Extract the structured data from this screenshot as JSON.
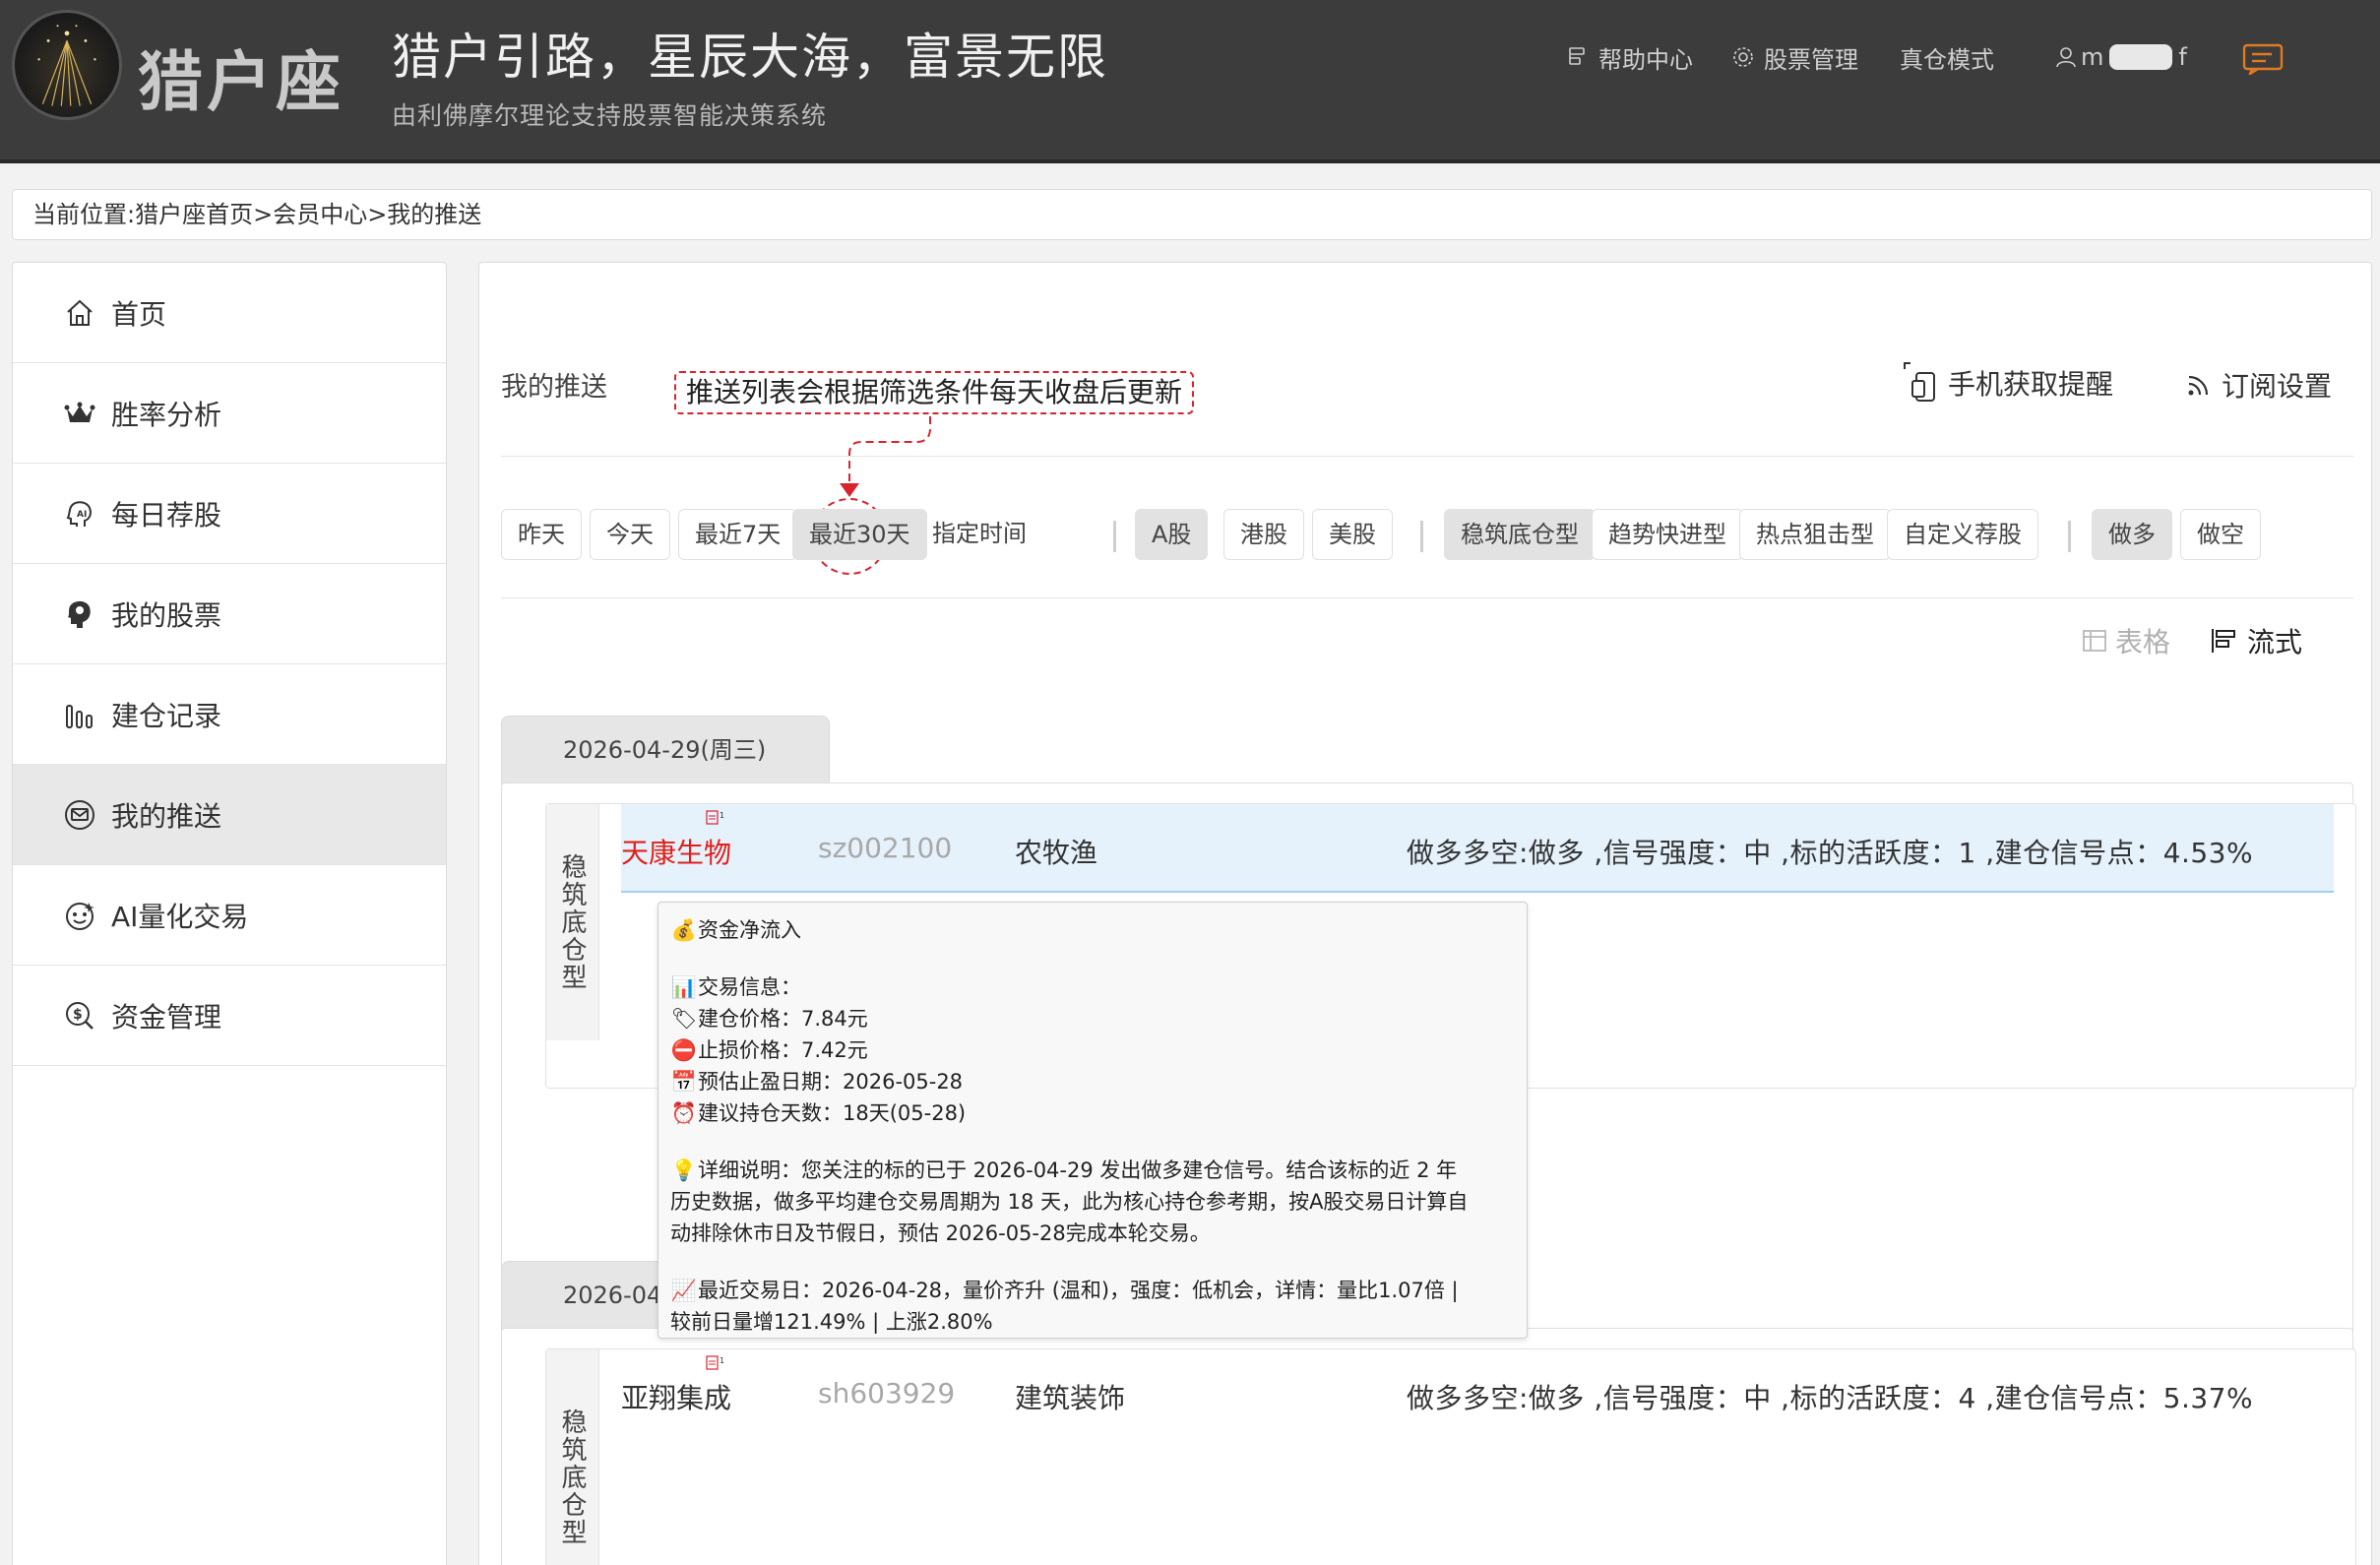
{
  "header": {
    "logo_text": "猎户座",
    "slogan": "猎户引路，星辰大海，富景无限",
    "subslogan": "由利佛摩尔理论支持股票智能决策系统",
    "nav": {
      "help": "帮助中心",
      "stock_mgmt": "股票管理",
      "real_mode": "真仓模式",
      "user_prefix": "m",
      "user_suffix": "f"
    }
  },
  "breadcrumb": "当前位置:猎户座首页>会员中心>我的推送",
  "sidebar": {
    "items": [
      {
        "label": "首页",
        "icon": "home-icon"
      },
      {
        "label": "胜率分析",
        "icon": "crown-icon"
      },
      {
        "label": "每日荐股",
        "icon": "ai-head-icon"
      },
      {
        "label": "我的股票",
        "icon": "brain-head-icon"
      },
      {
        "label": "建仓记录",
        "icon": "bar-chart-icon"
      },
      {
        "label": "我的推送",
        "icon": "push-message-icon"
      },
      {
        "label": "AI量化交易",
        "icon": "robot-face-icon"
      },
      {
        "label": "资金管理",
        "icon": "money-search-icon"
      }
    ]
  },
  "main": {
    "title": "我的推送",
    "annotation": "推送列表会根据筛选条件每天收盘后更新",
    "phone_link": "手机获取提醒",
    "subscribe_link": "订阅设置",
    "filters": {
      "time": [
        "昨天",
        "今天",
        "最近7天",
        "最近30天"
      ],
      "custom_time": "指定时间",
      "market": [
        "A股",
        "港股",
        "美股"
      ],
      "type": [
        "稳筑底仓型",
        "趋势快进型",
        "热点狙击型",
        "自定义荐股"
      ],
      "direction": [
        "做多",
        "做空"
      ]
    },
    "view": {
      "table": "表格",
      "flow": "流式"
    },
    "groups": [
      {
        "date": "2026-04-29(周三)",
        "tag": "稳筑底仓型",
        "stock": {
          "name": "天康生物",
          "code": "sz002100",
          "industry": "农牧渔",
          "info": "做多多空:做多 ,信号强度：中 ,标的活跃度：1 ,建仓信号点：4.53%"
        }
      },
      {
        "date": "2026-04",
        "tag": "稳筑底仓型",
        "stock": {
          "name": "亚翔集成",
          "code": "sh603929",
          "industry": "建筑装饰",
          "info": "做多多空:做多 ,信号强度：中 ,标的活跃度：4 ,建仓信号点：5.37%"
        }
      }
    ]
  },
  "tooltip": {
    "inflow": "资金净流入",
    "trade_info": "交易信息：",
    "entry_price": "建仓价格：7.84元",
    "stop_loss": "止损价格：7.42元",
    "target_date": "预估止盈日期：2026-05-28",
    "hold_days": "建议持仓天数：18天(05-28)",
    "detail_1": "详细说明：您关注的标的已于 2026-04-29 发出做多建仓信号。结合该标的近 2 年",
    "detail_2": "历史数据，做多平均建仓交易周期为 18 天，此为核心持仓参考期，按A股交易日计算自",
    "detail_3": "动排除休市日及节假日，预估 2026-05-28完成本轮交易。",
    "last_1": "最近交易日：2026-04-28，量价齐升 (温和)，强度：低机会，详情：量比1.07倍 |",
    "last_2": "较前日量增121.49% | 上涨2.80%"
  },
  "colors": {
    "header_bg": "#3c3c3c",
    "accent_red": "#e0201b",
    "annotation": "#d9232d",
    "highlight_row": "#e5f2fb",
    "chat_icon": "#e07b22"
  }
}
